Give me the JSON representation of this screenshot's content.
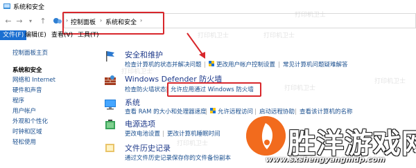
{
  "window": {
    "title": "系统和安全"
  },
  "nav": {
    "back": "←",
    "forward": "→",
    "dropdown": "▾",
    "up": "↑"
  },
  "breadcrumb": {
    "items": [
      "控制面板",
      "系统和安全"
    ],
    "separator": "›"
  },
  "menu": {
    "file": "文件(F)",
    "edit": "编辑(E)",
    "view": "查看(V)",
    "tools": "工具(T)"
  },
  "sidebar": {
    "items": [
      {
        "label": "控制面板主页"
      },
      {
        "label": "系统和安全"
      },
      {
        "label": "网络和 Internet"
      },
      {
        "label": "硬件和声音"
      },
      {
        "label": "程序"
      },
      {
        "label": "用户帐户"
      },
      {
        "label": "外观和个性化"
      },
      {
        "label": "时钟和区域"
      },
      {
        "label": "轻松使用"
      }
    ]
  },
  "categories": {
    "security": {
      "title": "安全和维护",
      "links": [
        "检查计算机的状态并解决问题",
        "更改用户帐户控制设置",
        "常见计算机问题疑难解答"
      ]
    },
    "firewall": {
      "title": "Windows Defender 防火墙",
      "links": [
        "检查防火墙状态",
        "允许应用通过 Windows 防火墙"
      ]
    },
    "system": {
      "title": "系统",
      "links": [
        "查看 RAM 的大小和处理器速度",
        "允许远程访问",
        "启动远程协助",
        "查看该计算机的名称"
      ]
    },
    "power": {
      "title": "电源选项",
      "links": [
        "更改电池设置",
        "更改计算机睡眠时间"
      ]
    },
    "filehistory": {
      "title": "文件历史记录",
      "links": [
        "通过文件历史记录保存你的文件备份副本"
      ]
    }
  },
  "watermark": {
    "text": "打印机卫士"
  },
  "logo": {
    "name": "胜洋游戏网",
    "url": "www.sxshengyangmdp.com"
  },
  "colors": {
    "accent": "#1a6fd1",
    "highlight": "#d8262b",
    "link": "#1a4f8f",
    "logo": "#f26b1d"
  }
}
